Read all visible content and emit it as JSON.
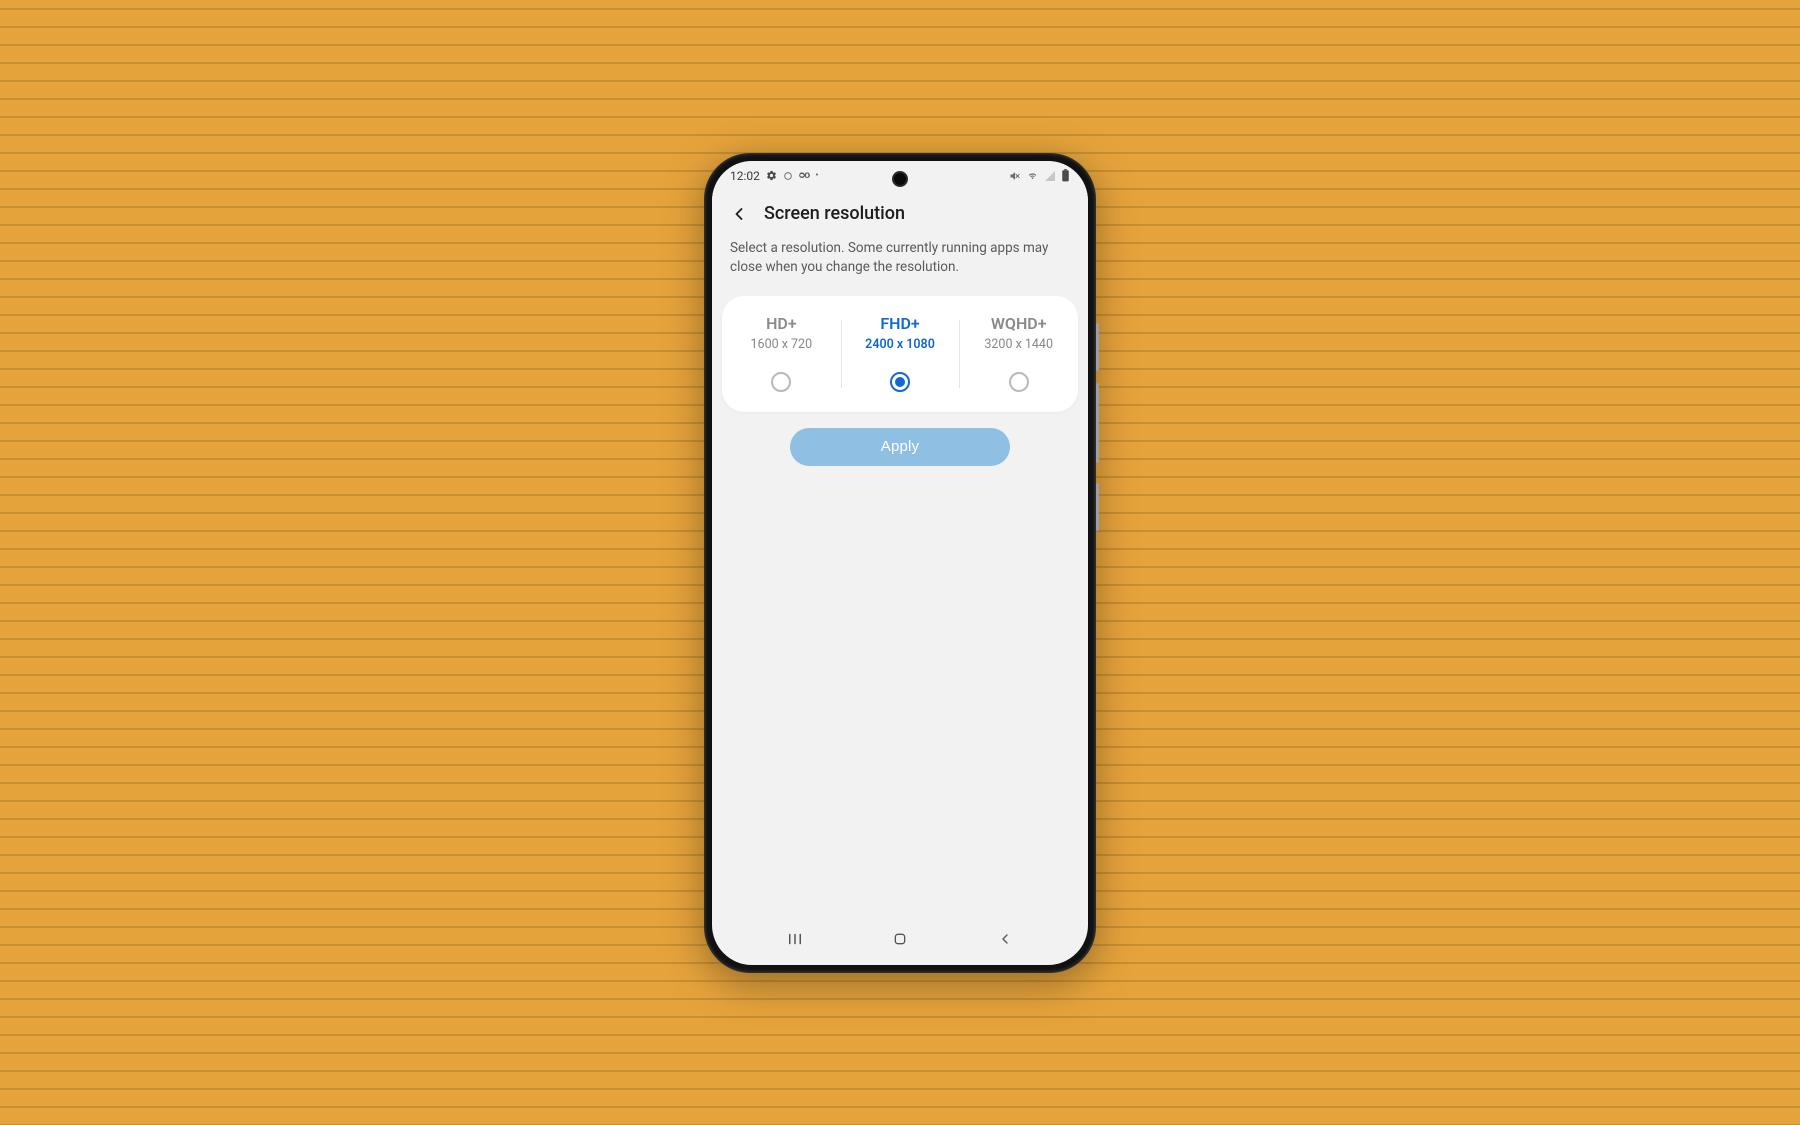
{
  "statusbar": {
    "time": "12:02",
    "left_icons": [
      "gear-icon",
      "circle-icon",
      "voicemail-icon",
      "dot-icon"
    ],
    "right_icons": [
      "mute-icon",
      "wifi-icon",
      "signal-icon",
      "battery-icon"
    ]
  },
  "header": {
    "title": "Screen resolution"
  },
  "description": "Select a resolution. Some currently running apps may close when you change the resolution.",
  "options": [
    {
      "label": "HD+",
      "detail": "1600 x 720",
      "selected": false
    },
    {
      "label": "FHD+",
      "detail": "2400 x 1080",
      "selected": true
    },
    {
      "label": "WQHD+",
      "detail": "3200 x 1440",
      "selected": false
    }
  ],
  "buttons": {
    "apply": "Apply"
  },
  "colors": {
    "accent": "#1169d3",
    "apply_bg": "#8fbfe2",
    "page_bg": "#e5a33b"
  }
}
